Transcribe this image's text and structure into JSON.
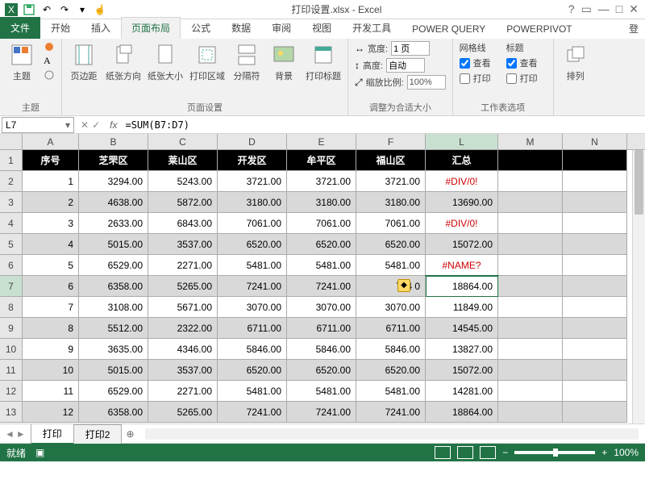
{
  "title": "打印设置.xlsx - Excel",
  "tabs": {
    "file": "文件",
    "home": "开始",
    "insert": "插入",
    "layout": "页面布局",
    "formula": "公式",
    "data": "数据",
    "review": "审阅",
    "view": "视图",
    "dev": "开发工具",
    "pq": "POWER QUERY",
    "pp": "POWERPIVOT"
  },
  "login": "登",
  "groups": {
    "theme": {
      "label": "主题",
      "theme": "主题"
    },
    "pagesetup": {
      "label": "页面设置",
      "margins": "页边距",
      "orient": "纸张方向",
      "size": "纸张大小",
      "area": "打印区域",
      "breaks": "分隔符",
      "bg": "背景",
      "titles": "打印标题"
    },
    "scale": {
      "label": "调整为合适大小",
      "width": "宽度:",
      "height": "高度:",
      "wval": "1 页",
      "hval": "自动",
      "ratio": "缩放比例:",
      "rval": "100%"
    },
    "sheetopt": {
      "label": "工作表选项",
      "grid": "网格线",
      "head": "标题",
      "view": "查看",
      "print": "打印"
    },
    "arrange": {
      "label": "排列",
      "arr": "排列"
    }
  },
  "namebox": "L7",
  "formula": "=SUM(B7:D7)",
  "cols": [
    "A",
    "B",
    "C",
    "D",
    "E",
    "F",
    "L",
    "M",
    "N"
  ],
  "headers": [
    "序号",
    "芝罘区",
    "莱山区",
    "开发区",
    "牟平区",
    "福山区",
    "汇总"
  ],
  "rows": [
    {
      "n": "1",
      "v": [
        "1",
        "3294.00",
        "5243.00",
        "3721.00",
        "3721.00",
        "3721.00",
        "#DIV/0!"
      ],
      "err": 6
    },
    {
      "n": "2",
      "v": [
        "2",
        "4638.00",
        "5872.00",
        "3180.00",
        "3180.00",
        "3180.00",
        "13690.00"
      ]
    },
    {
      "n": "3",
      "v": [
        "3",
        "2633.00",
        "6843.00",
        "7061.00",
        "7061.00",
        "7061.00",
        "#DIV/0!"
      ],
      "err": 6
    },
    {
      "n": "4",
      "v": [
        "4",
        "5015.00",
        "3537.00",
        "6520.00",
        "6520.00",
        "6520.00",
        "15072.00"
      ]
    },
    {
      "n": "5",
      "v": [
        "5",
        "6529.00",
        "2271.00",
        "5481.00",
        "5481.00",
        "5481.00",
        "#NAME?"
      ],
      "err": 6
    },
    {
      "n": "6",
      "v": [
        "6",
        "6358.00",
        "5265.00",
        "7241.00",
        "7241.00",
        "724   0",
        "18864.00"
      ],
      "smart": 5,
      "sel": 6
    },
    {
      "n": "7",
      "v": [
        "7",
        "3108.00",
        "5671.00",
        "3070.00",
        "3070.00",
        "3070.00",
        "11849.00"
      ]
    },
    {
      "n": "8",
      "v": [
        "8",
        "5512.00",
        "2322.00",
        "6711.00",
        "6711.00",
        "6711.00",
        "14545.00"
      ]
    },
    {
      "n": "9",
      "v": [
        "9",
        "3635.00",
        "4346.00",
        "5846.00",
        "5846.00",
        "5846.00",
        "13827.00"
      ]
    },
    {
      "n": "10",
      "v": [
        "10",
        "5015.00",
        "3537.00",
        "6520.00",
        "6520.00",
        "6520.00",
        "15072.00"
      ]
    },
    {
      "n": "11",
      "v": [
        "11",
        "6529.00",
        "2271.00",
        "5481.00",
        "5481.00",
        "5481.00",
        "14281.00"
      ]
    },
    {
      "n": "12",
      "v": [
        "12",
        "6358.00",
        "5265.00",
        "7241.00",
        "7241.00",
        "7241.00",
        "18864.00"
      ]
    }
  ],
  "sheets": {
    "s1": "打印",
    "s2": "打印2"
  },
  "status": {
    "ready": "就绪",
    "zoom": "100%"
  }
}
